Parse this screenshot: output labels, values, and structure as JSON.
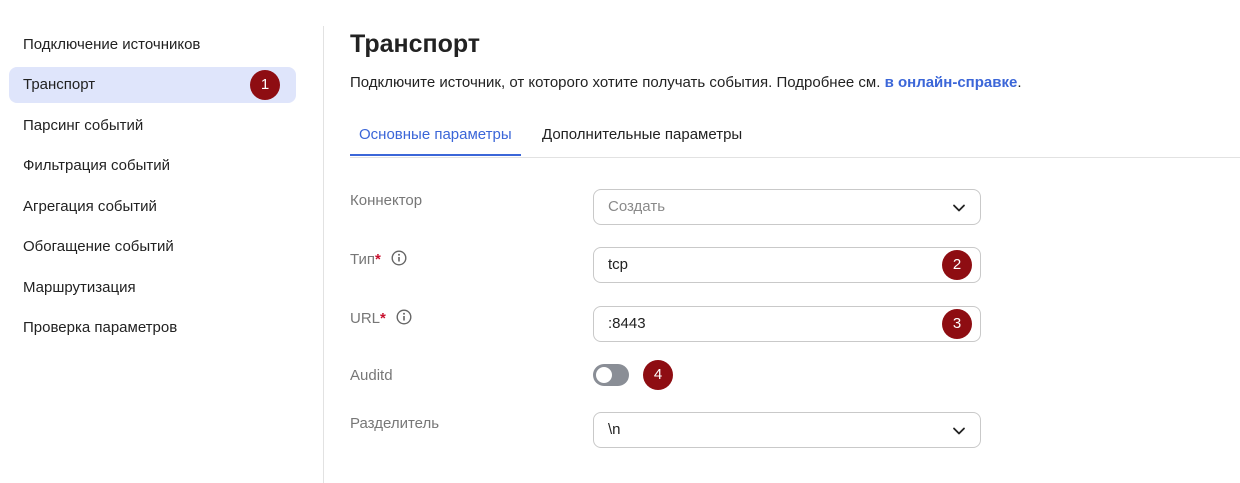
{
  "sidebar": {
    "items": [
      {
        "label": "Подключение источников"
      },
      {
        "label": "Транспорт",
        "active": true,
        "badge": "1"
      },
      {
        "label": "Парсинг событий"
      },
      {
        "label": "Фильтрация событий"
      },
      {
        "label": "Агрегация событий"
      },
      {
        "label": "Обогащение событий"
      },
      {
        "label": "Маршрутизация"
      },
      {
        "label": "Проверка параметров"
      }
    ]
  },
  "main": {
    "title": "Транспорт",
    "subtitle_text": "Подключите источник, от которого хотите получать события. Подробнее см. ",
    "subtitle_link": "в онлайн-справке",
    "subtitle_end": ".",
    "tabs": [
      {
        "label": "Основные параметры",
        "active": true
      },
      {
        "label": "Дополнительные параметры",
        "active": false
      }
    ],
    "fields": {
      "connector": {
        "label": "Коннектор",
        "placeholder": "Создать"
      },
      "type": {
        "label": "Тип",
        "required_mark": "*",
        "value": "tcp",
        "badge": "2"
      },
      "url": {
        "label": "URL",
        "required_mark": "*",
        "value": ":8443",
        "badge": "3"
      },
      "auditd": {
        "label": "Auditd",
        "enabled": false,
        "badge": "4"
      },
      "delimiter": {
        "label": "Разделитель",
        "value": "\\n"
      }
    }
  },
  "colors": {
    "accent": "#3b66d8",
    "active_nav_bg": "#dfe5fb",
    "badge": "#8e0d12",
    "required": "#c8102e",
    "toggle_off": "#8a8e96"
  },
  "icons": {
    "info": "info-circle-icon",
    "chevron": "chevron-down-icon"
  }
}
